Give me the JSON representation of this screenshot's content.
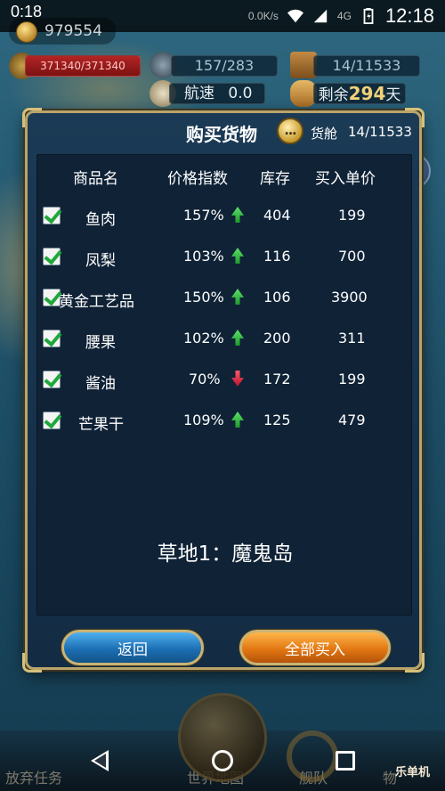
{
  "status_bar": {
    "time_left": "0:18",
    "net": "0.0K/s",
    "network_type": "4G",
    "clock": "12:18"
  },
  "hud": {
    "gold": "979554",
    "hp": "371340/371340",
    "crew": "157/283",
    "cargo": "14/11533",
    "speed_label": "航速",
    "speed_value": "0.0",
    "days_prefix": "剩余",
    "days_value": "294",
    "days_suffix": "天"
  },
  "dialog": {
    "title": "购买货物",
    "chat_icon": "...",
    "hold_label": "货舱",
    "hold_value": "14/11533",
    "columns": [
      "商品名",
      "价格指数",
      "库存",
      "买入单价"
    ],
    "goods": [
      {
        "name": "鱼肉",
        "index": "157%",
        "trend": "up",
        "stock": "404",
        "price": "199"
      },
      {
        "name": "凤梨",
        "index": "103%",
        "trend": "up",
        "stock": "116",
        "price": "700"
      },
      {
        "name": "黄金工艺品",
        "index": "150%",
        "trend": "up",
        "stock": "106",
        "price": "3900"
      },
      {
        "name": "腰果",
        "index": "102%",
        "trend": "up",
        "stock": "200",
        "price": "311"
      },
      {
        "name": "酱油",
        "index": "70%",
        "trend": "down",
        "stock": "172",
        "price": "199"
      },
      {
        "name": "芒果干",
        "index": "109%",
        "trend": "up",
        "stock": "125",
        "price": "479"
      }
    ],
    "location": "草地1：魔鬼岛",
    "back_label": "返回",
    "buy_all_label": "全部买入"
  },
  "bottom_bar": {
    "abandon_label": "放弃任务",
    "world_map_label": "世界地图",
    "fleet_label": "舰队",
    "goods_label": "物",
    "watermark": "乐单机"
  },
  "colors": {
    "trend_up": "#2fbf45",
    "trend_down": "#e0203a",
    "frame_gold": "#b9a46a"
  }
}
